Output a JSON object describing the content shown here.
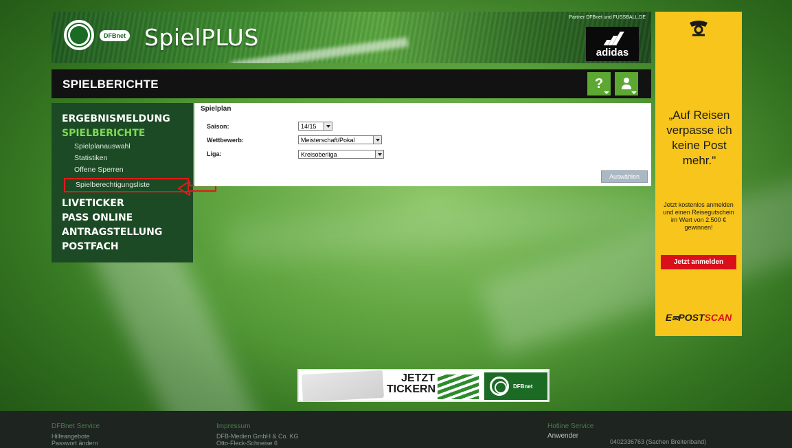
{
  "header": {
    "logo_text": "DFBnet",
    "app_title": "SpielPLUS",
    "partner_text": "Partner DFBnet und FUSSBALL.DE",
    "sponsor": "adidas"
  },
  "titlebar": {
    "title": "SPIELBERICHTE",
    "help_label": "?"
  },
  "sidebar": {
    "items": [
      {
        "label": "ERGEBNISMELDUNG"
      },
      {
        "label": "SPIELBERICHTE"
      },
      {
        "label": "LIVETICKER"
      },
      {
        "label": "PASS ONLINE"
      },
      {
        "label": "ANTRAGSTELLUNG"
      },
      {
        "label": "POSTFACH"
      }
    ],
    "sub_items": [
      {
        "label": "Spielplanauswahl"
      },
      {
        "label": "Statistiken"
      },
      {
        "label": "Offene Sperren"
      },
      {
        "label": "Spielberechtigungsliste"
      }
    ]
  },
  "panel": {
    "title": "Spielplan",
    "fields": [
      {
        "label": "Saison:",
        "value": "14/15"
      },
      {
        "label": "Wettbewerb:",
        "value": "Meisterschaft/Pokal"
      },
      {
        "label": "Liga:",
        "value": "Kreisoberliga"
      }
    ],
    "submit_label": "Auswählen"
  },
  "ad": {
    "quote": "„Auf Reisen verpasse ich keine Post mehr.\"",
    "small_text": "Jetzt kostenlos anmelden und einen Reisegutschein im Wert von 2.500 € gewinnen!",
    "button_label": "Jetzt anmelden",
    "brand_a": "E",
    "brand_b": "POST",
    "brand_c": "SCAN"
  },
  "banner": {
    "line1": "JETZT",
    "line2": "TICKERN",
    "logo_text": "DFBnet"
  },
  "footer": {
    "col1_title": "DFBnet Service",
    "col1_lines": [
      "Hilfeangebote",
      "Passwort ändern"
    ],
    "col2_title": "Impressum",
    "col2_lines": [
      "DFB-Medien GmbH & Co. KG",
      "Otto-Fleck-Schneise 6"
    ],
    "col3_title": "Hotline Service",
    "col3_label": "Anwender",
    "col3_value": "0402336763 (Sachen Breitenband)"
  },
  "colors": {
    "accent_green": "#5da832",
    "sidebar_bg": "#1c4a24",
    "active_nav": "#7ed957",
    "ad_yellow": "#f7c51b",
    "highlight_red": "#e21a1a"
  }
}
